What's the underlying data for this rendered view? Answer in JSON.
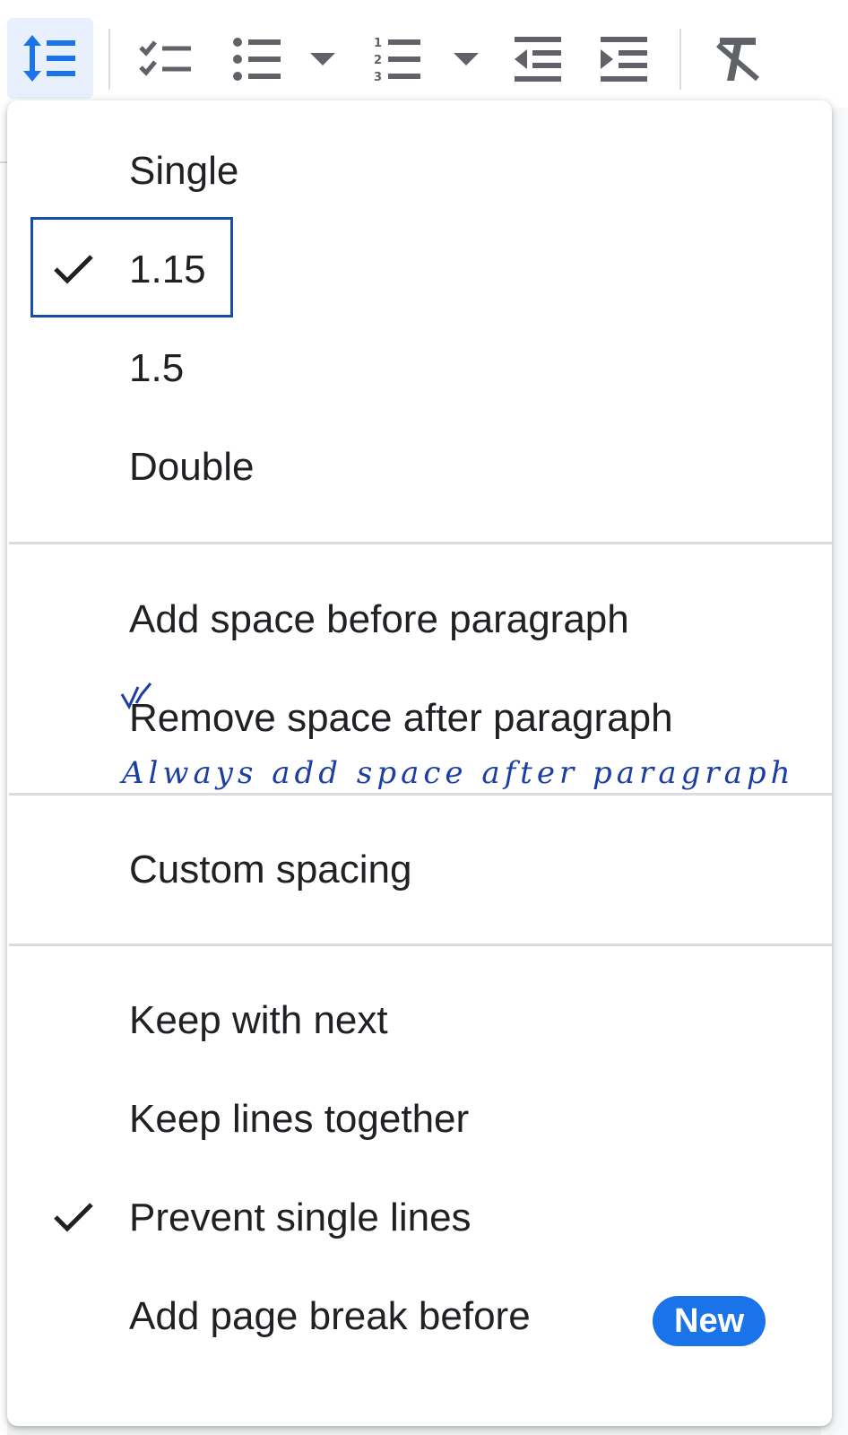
{
  "toolbar": {
    "buttons": [
      {
        "name": "line-spacing-icon",
        "active": true
      },
      {
        "name": "checklist-icon"
      },
      {
        "name": "bulleted-list-icon"
      },
      {
        "name": "bulleted-list-dropdown-icon"
      },
      {
        "name": "numbered-list-icon"
      },
      {
        "name": "numbered-list-dropdown-icon"
      },
      {
        "name": "decrease-indent-icon"
      },
      {
        "name": "increase-indent-icon"
      },
      {
        "name": "clear-formatting-icon"
      }
    ],
    "accent": "#1a73e8",
    "active_bg": "#e8f0fe"
  },
  "menu": {
    "spacing_options": [
      {
        "label": "Single",
        "checked": false
      },
      {
        "label": "1.15",
        "checked": true,
        "focused": true
      },
      {
        "label": "1.5",
        "checked": false
      },
      {
        "label": "Double",
        "checked": false
      }
    ],
    "paragraph_options": [
      {
        "label": "Add space before paragraph"
      },
      {
        "label": "Remove space after paragraph"
      }
    ],
    "custom": {
      "label": "Custom spacing"
    },
    "pagination_options": [
      {
        "label": "Keep with next",
        "checked": false
      },
      {
        "label": "Keep lines together",
        "checked": false
      },
      {
        "label": "Prevent single lines",
        "checked": true
      },
      {
        "label": "Add page break before",
        "checked": false,
        "badge": "New"
      }
    ]
  },
  "annotation": {
    "text": "Always add space after paragraph",
    "color": "#1a3ea6"
  }
}
